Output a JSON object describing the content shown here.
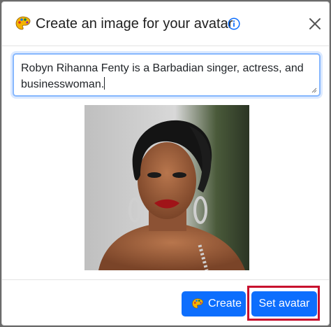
{
  "dialog": {
    "title": "Create an image for your avatar",
    "title_icon": "palette-icon",
    "info_icon": "info-icon",
    "close_icon": "close-icon"
  },
  "prompt": {
    "value": "Robyn Rihanna Fenty is a Barbadian singer, actress, and businesswoman."
  },
  "preview": {
    "description_icon": "generated-avatar-image"
  },
  "footer": {
    "create_label": "Create",
    "create_icon": "palette-icon",
    "set_avatar_label": "Set avatar"
  },
  "colors": {
    "primary": "#0d6efd",
    "highlight": "#c8102e",
    "info": "#0d6efd"
  }
}
